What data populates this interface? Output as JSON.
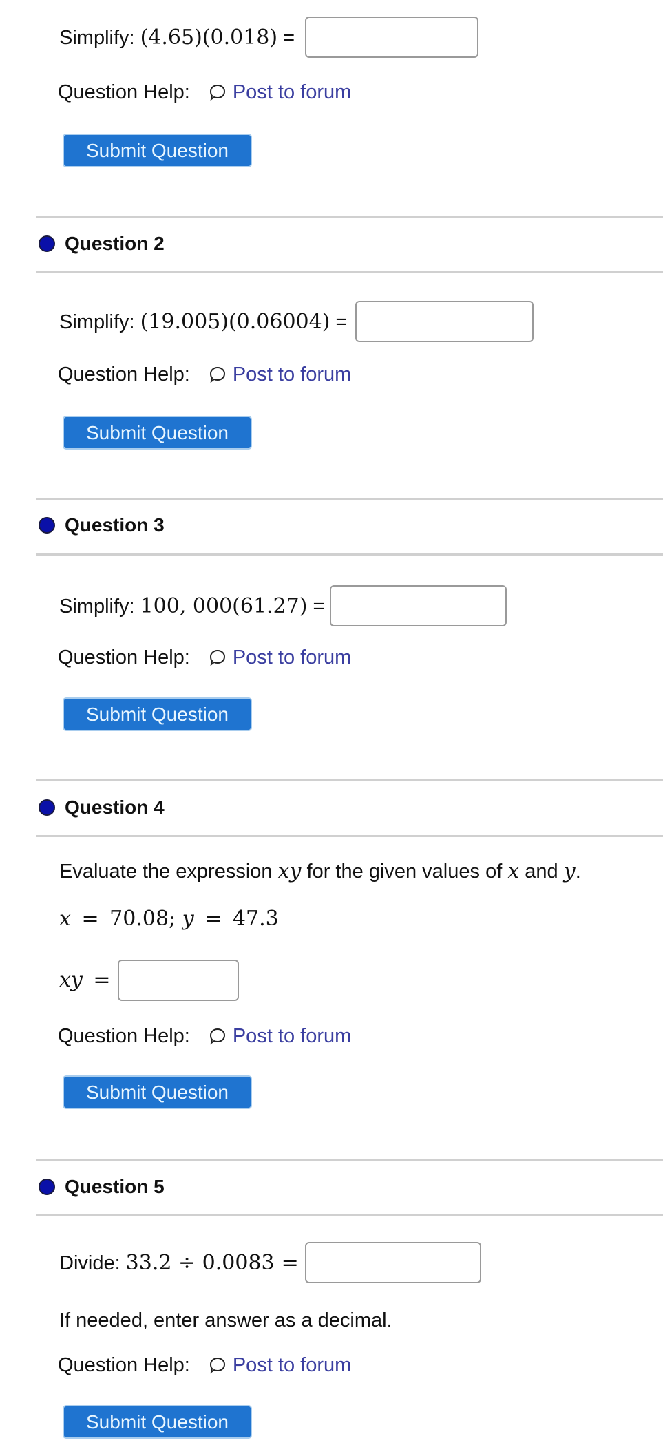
{
  "common": {
    "help_label": "Question Help:",
    "forum_link": "Post to forum",
    "forum_icon": "speech-bubble-icon",
    "submit_label": "Submit Question"
  },
  "colors": {
    "button_bg": "#1f74d0",
    "link": "#3a3ea0",
    "bullet": "#0a10a8",
    "divider": "#d0d0d0"
  },
  "questions": [
    {
      "title": "",
      "prompt_label": "Simplify:",
      "expression": "(4.65)(0.018)",
      "equals": "=",
      "answer_value": ""
    },
    {
      "title": "Question 2",
      "prompt_label": "Simplify:",
      "expression": "(19.005)(0.06004)",
      "equals": "=",
      "answer_value": ""
    },
    {
      "title": "Question 3",
      "prompt_label": "Simplify:",
      "expression": "100, 000(61.27)",
      "equals": "=",
      "answer_value": ""
    },
    {
      "title": "Question 4",
      "instruction_parts": [
        "Evaluate the expression ",
        "xy",
        " for the given values of ",
        "x",
        " and ",
        "y",
        "."
      ],
      "given_x_var": "x",
      "given_eq": "=",
      "given_x_val": "70.08;",
      "given_y_var": "y",
      "given_y_val": "47.3",
      "answer_lhs": "xy",
      "answer_eq": "=",
      "answer_value": ""
    },
    {
      "title": "Question 5",
      "prompt_label": "Divide:",
      "expression": "33.2 ÷ 0.0083",
      "equals": "=",
      "answer_value": "",
      "note": "If needed, enter answer as a decimal."
    }
  ]
}
